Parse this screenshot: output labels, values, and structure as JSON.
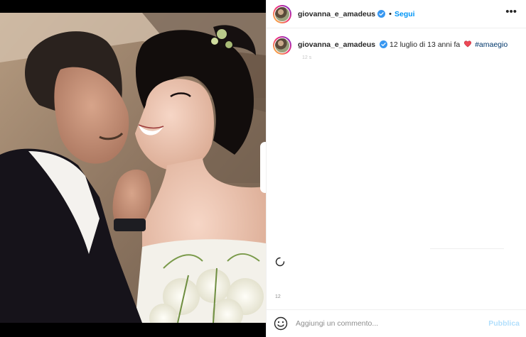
{
  "post": {
    "username": "giovanna_e_amadeus",
    "verified_icon": "verified-badge-icon",
    "follow_label": "Segui",
    "more_icon": "more-options-icon",
    "more_label": "•••"
  },
  "caption": {
    "username": "giovanna_e_amadeus",
    "text": "12 luglio di 13 anni fa",
    "heart_icon": "red-heart-emoji",
    "hashtag": "#amaegio",
    "time": "12 s"
  },
  "engagement": {
    "loading_icon": "loading-spinner-icon",
    "likes": "12"
  },
  "comment": {
    "emoji_icon": "smiley-face-icon",
    "placeholder": "Aggiungi un commento...",
    "publish_label": "Pubblica"
  },
  "colors": {
    "follow_blue": "#0095f6",
    "publish_disabled": "#b2dffc",
    "hashtag_link": "#00376b",
    "verified_blue": "#3897f0",
    "heart_red": "#ed4956"
  }
}
